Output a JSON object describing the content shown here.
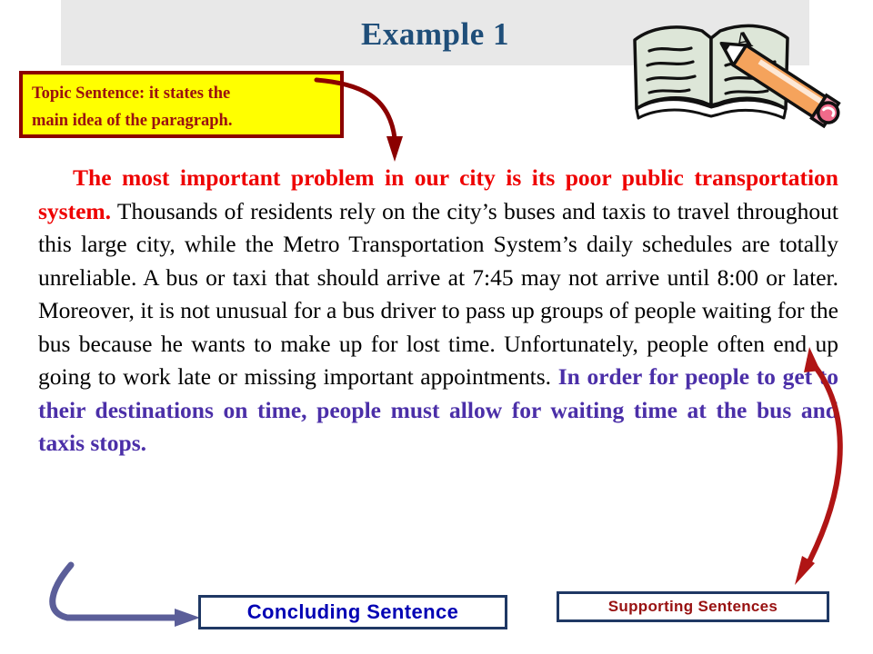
{
  "slide": {
    "title": "Example 1",
    "background_color": "#ffffff",
    "title_band_color": "#e8e8e8",
    "title_color": "#1f4e79"
  },
  "callout": {
    "topic_label_line1": "Topic Sentence:  it states the",
    "topic_label_line2": "main idea of the paragraph.",
    "fill_color": "#ffff00",
    "border_color": "#8b0000",
    "text_color": "#9a1010"
  },
  "paragraph": {
    "topic_sentence": "The most important problem in our city is its poor public transportation system.",
    "supporting_sentences": " Thousands of residents rely on the city’s buses and taxis to travel throughout this large city, while the Metro Transportation System’s daily schedules are totally unreliable.  A bus or taxi that should arrive at 7:45 may not arrive until 8:00 or later.  Moreover, it is not unusual for a bus driver to pass up groups of people waiting for the bus because he wants to make up for lost time.  Unfortunately, people often end up going to work late or missing important appointments. ",
    "concluding_sentence": "In order for people to get to their destinations on time, people must allow for waiting time at the bus and taxis stops.",
    "topic_color": "#ee0000",
    "body_color": "#000000",
    "concluding_color": "#4b2fa8"
  },
  "labels": {
    "concluding": "Concluding Sentence",
    "supporting": "Supporting Sentences",
    "concluding_color": "#0000b4",
    "supporting_color": "#981111",
    "box_border_color": "#1f3864"
  },
  "arrows": {
    "topic_arrow_color": "#8b0000",
    "supporting_arrow_color": "#b01515",
    "concluding_arrow_color": "#5b5e99"
  },
  "clipart": {
    "name": "open-book-and-pencil",
    "grade_letter": "A",
    "book_page_color": "#dde6d8",
    "pencil_body_color": "#f5a35c",
    "eraser_color": "#f5a0b4"
  }
}
